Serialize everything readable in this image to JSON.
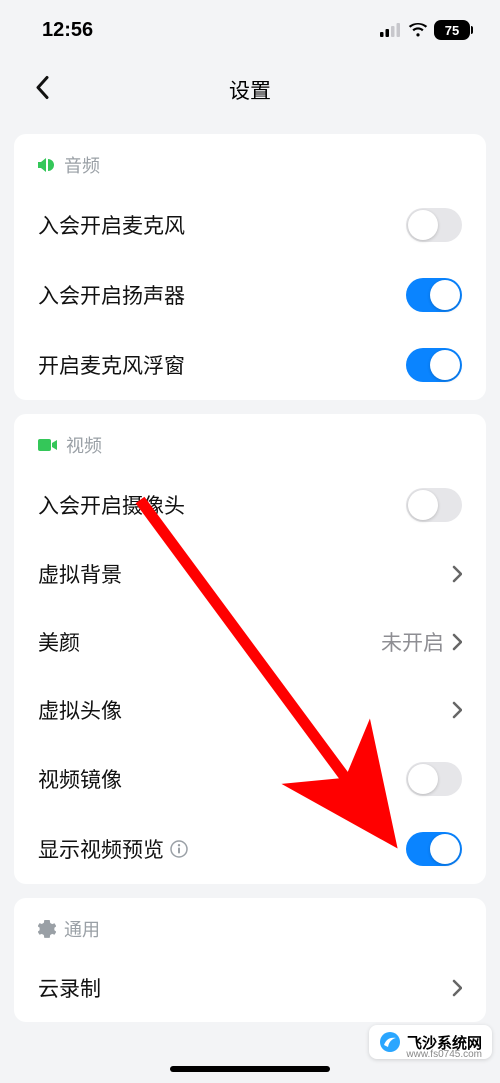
{
  "status": {
    "time": "12:56",
    "battery": "75"
  },
  "nav": {
    "title": "设置"
  },
  "sections": {
    "audio": {
      "header": "音频",
      "rows": {
        "mic": "入会开启麦克风",
        "speaker": "入会开启扬声器",
        "mic_float": "开启麦克风浮窗"
      }
    },
    "video": {
      "header": "视频",
      "rows": {
        "camera": "入会开启摄像头",
        "vbg": "虚拟背景",
        "beauty": "美颜",
        "beauty_value": "未开启",
        "vavatar": "虚拟头像",
        "mirror": "视频镜像",
        "preview": "显示视频预览"
      }
    },
    "general": {
      "header": "通用",
      "rows": {
        "cloud_rec": "云录制"
      }
    }
  },
  "watermark": {
    "text": "飞沙系统网",
    "sub": "www.fs0745.com"
  },
  "toggles": {
    "mic": false,
    "speaker": true,
    "mic_float": true,
    "camera": false,
    "mirror": false,
    "preview": true
  },
  "colors": {
    "accent": "#0a84ff",
    "bg": "#f3f4f6"
  }
}
